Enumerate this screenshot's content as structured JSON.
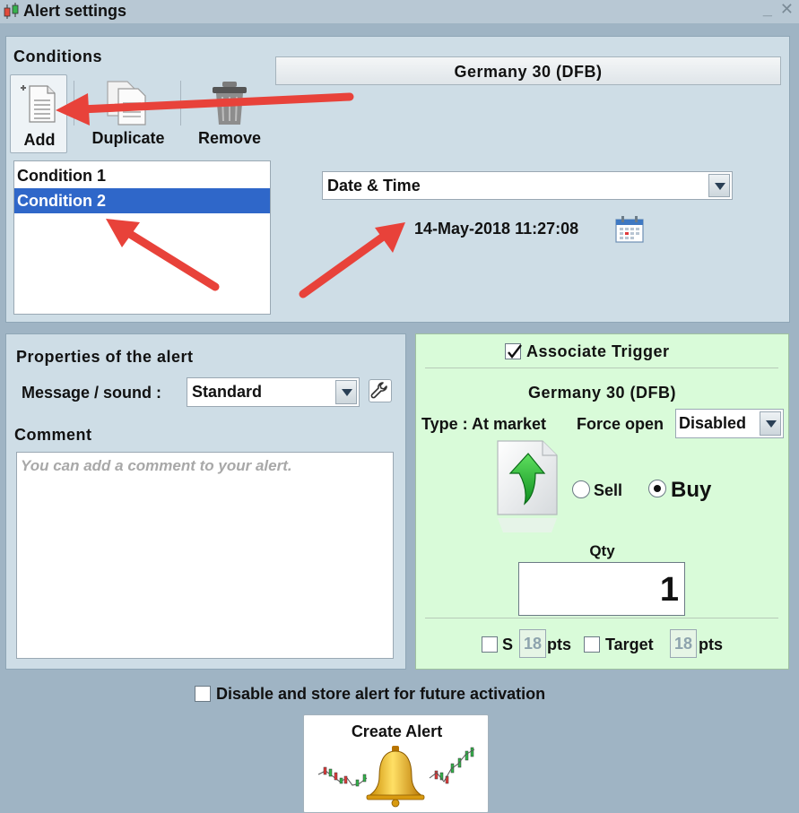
{
  "window": {
    "title": "Alert settings",
    "minimize": "_",
    "close": "✕"
  },
  "conditions": {
    "heading": "Conditions",
    "add_label": "Add",
    "duplicate_label": "Duplicate",
    "remove_label": "Remove",
    "instrument": "Germany 30 (DFB)",
    "items": [
      {
        "label": "Condition 1",
        "selected": false
      },
      {
        "label": "Condition 2",
        "selected": true
      }
    ],
    "type_select": "Date & Time",
    "datetime": "14-May-2018 11:27:08"
  },
  "properties": {
    "heading": "Properties of the alert",
    "message_label": "Message / sound :",
    "message_value": "Standard",
    "comment_heading": "Comment",
    "comment_placeholder": "You can add a comment to your alert."
  },
  "trigger": {
    "associate_label": "Associate Trigger",
    "associate_checked": true,
    "instrument": "Germany 30 (DFB)",
    "type_label": "Type : At market",
    "force_open_label": "Force open",
    "force_open_value": "Disabled",
    "sell_label": "Sell",
    "buy_label": "Buy",
    "selected_side": "Buy",
    "qty_label": "Qty",
    "qty_value": "1",
    "stop_label": "S",
    "stop_value": "18",
    "stop_unit": "pts",
    "target_label": "Target",
    "target_value": "18",
    "target_unit": "pts"
  },
  "footer": {
    "disable_label": "Disable and store alert for future activation",
    "create_label": "Create Alert"
  },
  "colors": {
    "background": "#9fb4c4",
    "panel": "#cedde6",
    "trigger_panel": "#d9fbd9",
    "selection": "#2f67c9",
    "annotation_arrow": "#e8423a"
  }
}
